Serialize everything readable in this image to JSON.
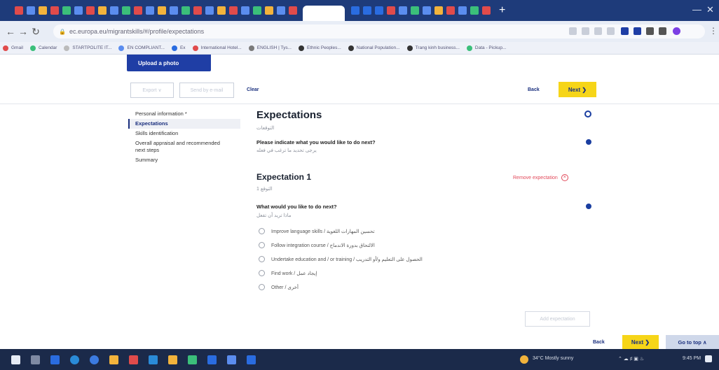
{
  "browser": {
    "url": "ec.europa.eu/migrantskills/#/profile/expectations",
    "tab_icon_colors": [
      "#e04b4b",
      "#5b8def",
      "#f2b33c",
      "#e04b4b",
      "#3bbf7a",
      "#5b8def",
      "#e04b4b",
      "#f2b33c",
      "#5b8def",
      "#3bbf7a",
      "#e04b4b",
      "#5b8def",
      "#f2b33c",
      "#5b8def",
      "#3bbf7a",
      "#e04b4b",
      "#5b8def",
      "#f2b33c",
      "#e04b4b",
      "#5b8def",
      "#3bbf7a",
      "#f2b33c",
      "#5b8def",
      "#e04b4b",
      "#ffffff",
      "#2a6ce0",
      "#2a6ce0",
      "#2a6ce0",
      "#e04b4b",
      "#5b8def",
      "#3bbf7a",
      "#5b8def",
      "#f2b33c",
      "#e04b4b",
      "#5b8def",
      "#3bbf7a",
      "#e04b4b"
    ],
    "new_tab": "+",
    "bookmarks": [
      {
        "label": "Gmail",
        "color": "#e04b4b"
      },
      {
        "label": "Calendar",
        "color": "#3bbf7a"
      },
      {
        "label": "STARTPOLITE IT...",
        "color": "#bbb"
      },
      {
        "label": "EN COMPLIANT...",
        "color": "#5b8def"
      },
      {
        "label": "Ex",
        "color": "#2a6ce0"
      },
      {
        "label": "International Hotel...",
        "color": "#e04b4b"
      },
      {
        "label": "ENGLISH | Tys...",
        "color": "#7a7a7a"
      },
      {
        "label": "Ethnic Peoples...",
        "color": "#333"
      },
      {
        "label": "National Population...",
        "color": "#333"
      },
      {
        "label": "Trang kinh business...",
        "color": "#333"
      },
      {
        "label": "Data - Pickup...",
        "color": "#3bbf7a"
      }
    ]
  },
  "toolbar": {
    "upload_label": "Upload a photo",
    "export_label": "Export ∨",
    "send_label": "Send by e-mail",
    "clear_label": "Clear",
    "back_label": "Back",
    "next_label": "Next ❯"
  },
  "sidenav": {
    "items": [
      {
        "label": "Personal information *",
        "active": false
      },
      {
        "label": "Expectations",
        "active": true
      },
      {
        "label": "Skills identification",
        "active": false
      },
      {
        "label": "Overall appraisal and recommended next steps",
        "active": false
      },
      {
        "label": "Summary",
        "active": false
      }
    ]
  },
  "main": {
    "title": "Expectations",
    "title_ar": "التوقعات",
    "question": "Please indicate what you would like to do next?",
    "question_ar": "يرجى تحديد ما ترغب في فعله",
    "expectation_title": "Expectation 1",
    "expectation_title_ar": "التوقع 1",
    "remove_label": "Remove expectation",
    "sub_question": "What would you like to do next?",
    "sub_question_ar": "ماذا تريد أن تفعل",
    "options": [
      "Improve language skills / تحسين المهارات اللغوية",
      "Follow integration course / الالتحاق بدورة الاندماج",
      "Undertake education and / or training / الحصول على التعليم و/أو التدريب",
      "Find work / إيجاد عمل",
      "Other / أخرى"
    ],
    "add_label": "Add expectation",
    "go_top_label": "Go to top ∧"
  },
  "taskbar": {
    "weather": "34°C Mostly sunny",
    "clock": "9:45 PM"
  }
}
